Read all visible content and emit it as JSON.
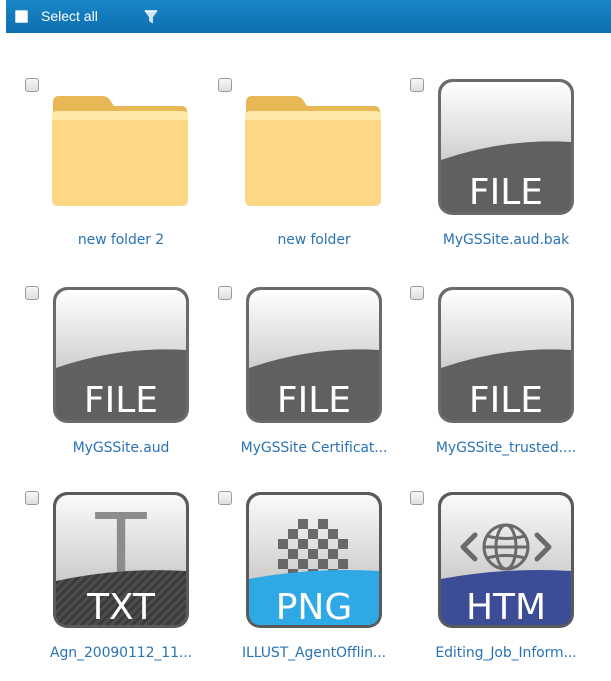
{
  "toolbar": {
    "select_all_label": "Select all"
  },
  "items": [
    {
      "name": "new folder 2",
      "type": "folder"
    },
    {
      "name": "new folder",
      "type": "folder"
    },
    {
      "name": "MyGSSite.aud.bak",
      "type": "file",
      "icon_label": "FILE"
    },
    {
      "name": "MyGSSite.aud",
      "type": "file",
      "icon_label": "FILE"
    },
    {
      "name": "MyGSSite Certificat...",
      "type": "file",
      "icon_label": "FILE"
    },
    {
      "name": "MyGSSite_trusted....",
      "type": "file",
      "icon_label": "FILE"
    },
    {
      "name": "Agn_20090112_11...",
      "type": "txt",
      "icon_label": "TXT"
    },
    {
      "name": "ILLUST_AgentOfflin...",
      "type": "png",
      "icon_label": "PNG"
    },
    {
      "name": "Editing_Job_Inform...",
      "type": "htm",
      "icon_label": "HTM"
    }
  ],
  "colors": {
    "toolbar": "#1172b7",
    "link": "#2a73b5",
    "png_band": "#2fa8e6",
    "htm_band": "#3d4c96"
  }
}
